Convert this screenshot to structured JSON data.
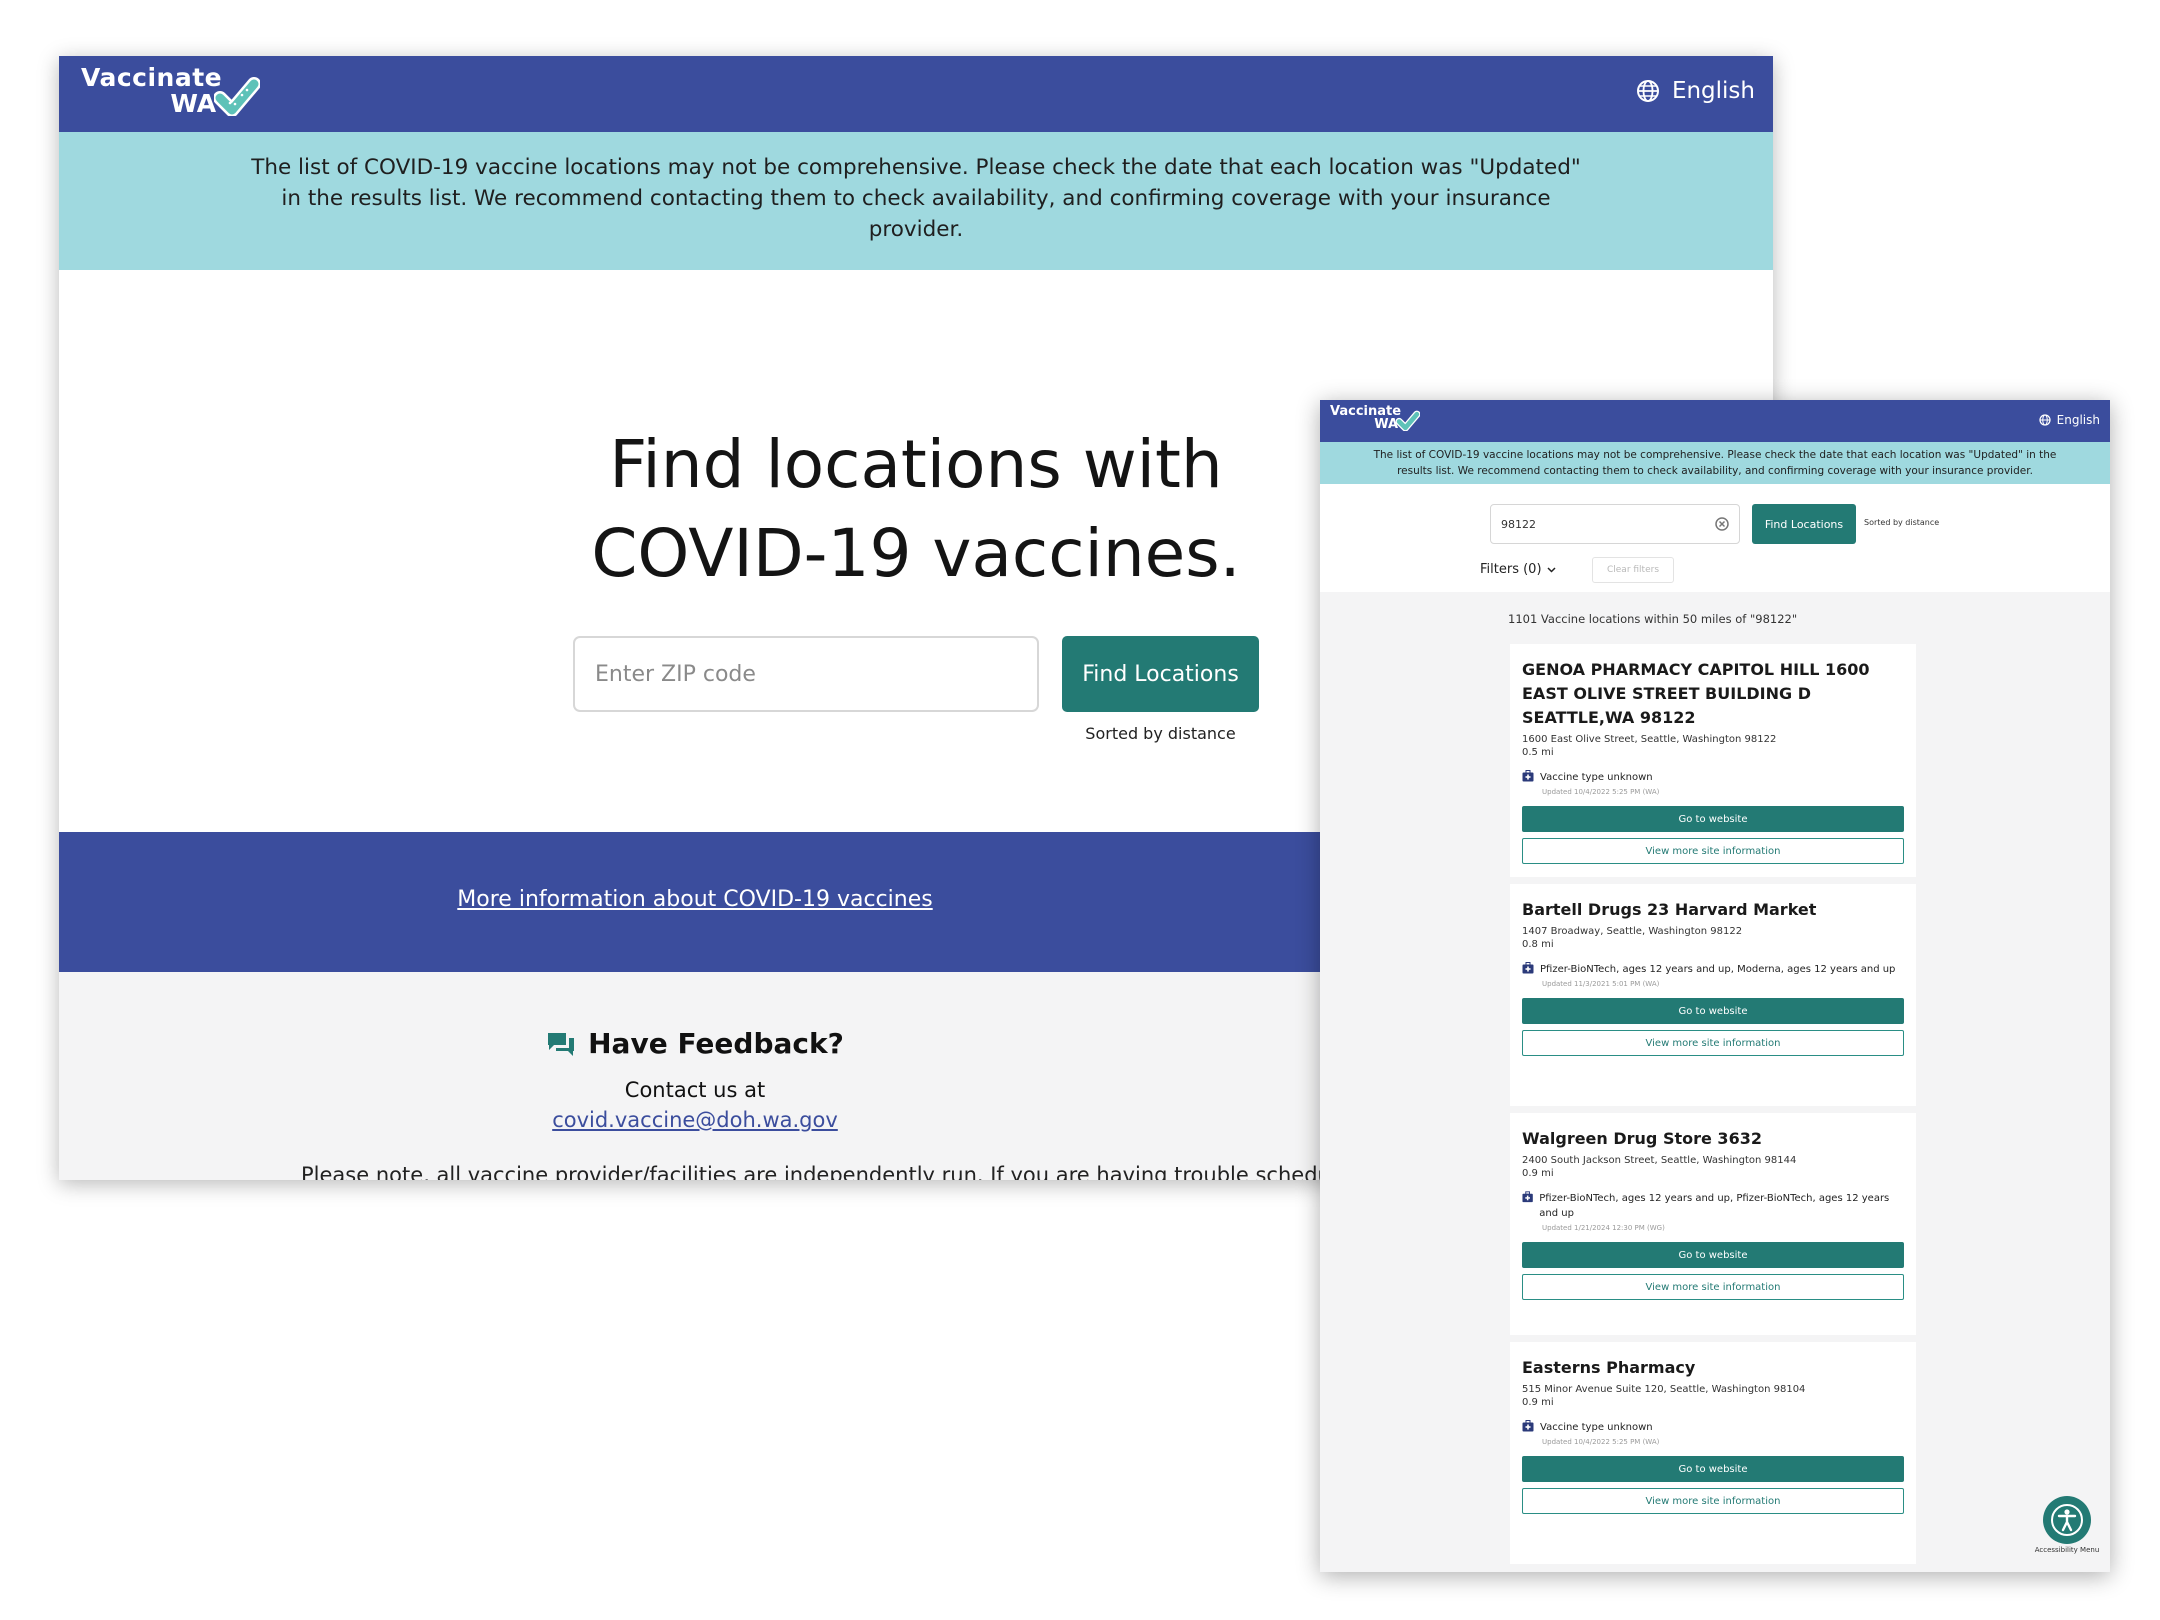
{
  "brand": {
    "line1": "Vaccinate",
    "line2": "WA",
    "primary_color": "#3b4d9d",
    "accent_color": "#237a74",
    "banner_color": "#9fd9df"
  },
  "header": {
    "language_label": "English",
    "language_icon": "globe-icon"
  },
  "banner": {
    "text": "The list of COVID-19 vaccine locations may not be comprehensive. Please check the date that each location was \"Updated\" in the results list. We recommend contacting them to check availability, and confirming coverage with your insurance provider."
  },
  "home": {
    "headline_line1": "Find locations with",
    "headline_line2": "COVID-19 vaccines.",
    "zip_placeholder": "Enter ZIP code",
    "find_button": "Find Locations",
    "sorted_label": "Sorted by distance",
    "more_info_link": "More information about COVID-19 vaccines",
    "feedback_title": "Have Feedback?",
    "feedback_icon": "chat-icon",
    "contact_label": "Contact us at",
    "contact_email": "covid.vaccine@doh.wa.gov",
    "note_text": "Please note, all vaccine provider/facilities are independently run. If you are having trouble scheduling"
  },
  "results": {
    "zip_value": "98122",
    "find_button": "Find Locations",
    "sorted_label": "Sorted by distance",
    "filters_label": "Filters (0)",
    "clear_filters_label": "Clear filters",
    "count_text": "1101 Vaccine locations within 50 miles of \"98122\"",
    "go_label": "Go to website",
    "more_label": "View more site information",
    "locations": [
      {
        "name": "GENOA PHARMACY CAPITOL HILL 1600 EAST OLIVE STREET BUILDING D SEATTLE,WA 98122",
        "address": "1600 East Olive Street, Seattle, Washington 98122",
        "distance": "0.5 mi",
        "vaccines": "Vaccine type unknown",
        "updated": "Updated 10/4/2022 5:25 PM (WA)"
      },
      {
        "name": "Bartell Drugs 23 Harvard Market",
        "address": "1407 Broadway, Seattle, Washington 98122",
        "distance": "0.8 mi",
        "vaccines": "Pfizer-BioNTech, ages 12 years and up, Moderna, ages 12 years and up",
        "updated": "Updated 11/3/2021 5:01 PM (WA)"
      },
      {
        "name": "Walgreen Drug Store 3632",
        "address": "2400 South Jackson Street, Seattle, Washington 98144",
        "distance": "0.9 mi",
        "vaccines": "Pfizer-BioNTech, ages 12 years and up, Pfizer-BioNTech, ages 12 years and up",
        "updated": "Updated 1/21/2024 12:30 PM (WG)"
      },
      {
        "name": "Easterns Pharmacy",
        "address": "515 Minor Avenue Suite 120, Seattle, Washington 98104",
        "distance": "0.9 mi",
        "vaccines": "Vaccine type unknown",
        "updated": "Updated 10/4/2022 5:25 PM (WA)"
      }
    ],
    "accessibility_label": "Accessibility Menu"
  }
}
